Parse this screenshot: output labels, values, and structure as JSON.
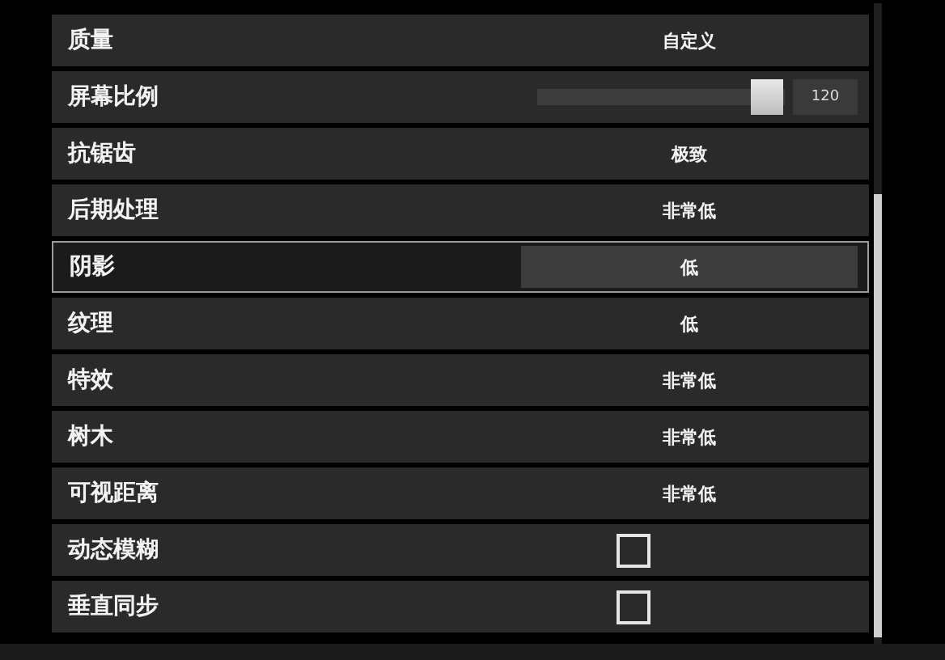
{
  "settings": [
    {
      "label": "质量",
      "kind": "value",
      "value": "自定义",
      "selected": false
    },
    {
      "label": "屏幕比例",
      "kind": "slider",
      "level": 0.93,
      "reading": "120",
      "selected": false
    },
    {
      "label": "抗锯齿",
      "kind": "value",
      "value": "极致",
      "selected": false
    },
    {
      "label": "后期处理",
      "kind": "value",
      "value": "非常低",
      "selected": false
    },
    {
      "label": "阴影",
      "kind": "value",
      "value": "低",
      "selected": true
    },
    {
      "label": "纹理",
      "kind": "value",
      "value": "低",
      "selected": false
    },
    {
      "label": "特效",
      "kind": "value",
      "value": "非常低",
      "selected": false
    },
    {
      "label": "树木",
      "kind": "value",
      "value": "非常低",
      "selected": false
    },
    {
      "label": "可视距离",
      "kind": "value",
      "value": "非常低",
      "selected": false
    },
    {
      "label": "动态模糊",
      "kind": "checkbox",
      "checked": false,
      "selected": false
    },
    {
      "label": "垂直同步",
      "kind": "checkbox",
      "checked": false,
      "selected": false
    }
  ]
}
